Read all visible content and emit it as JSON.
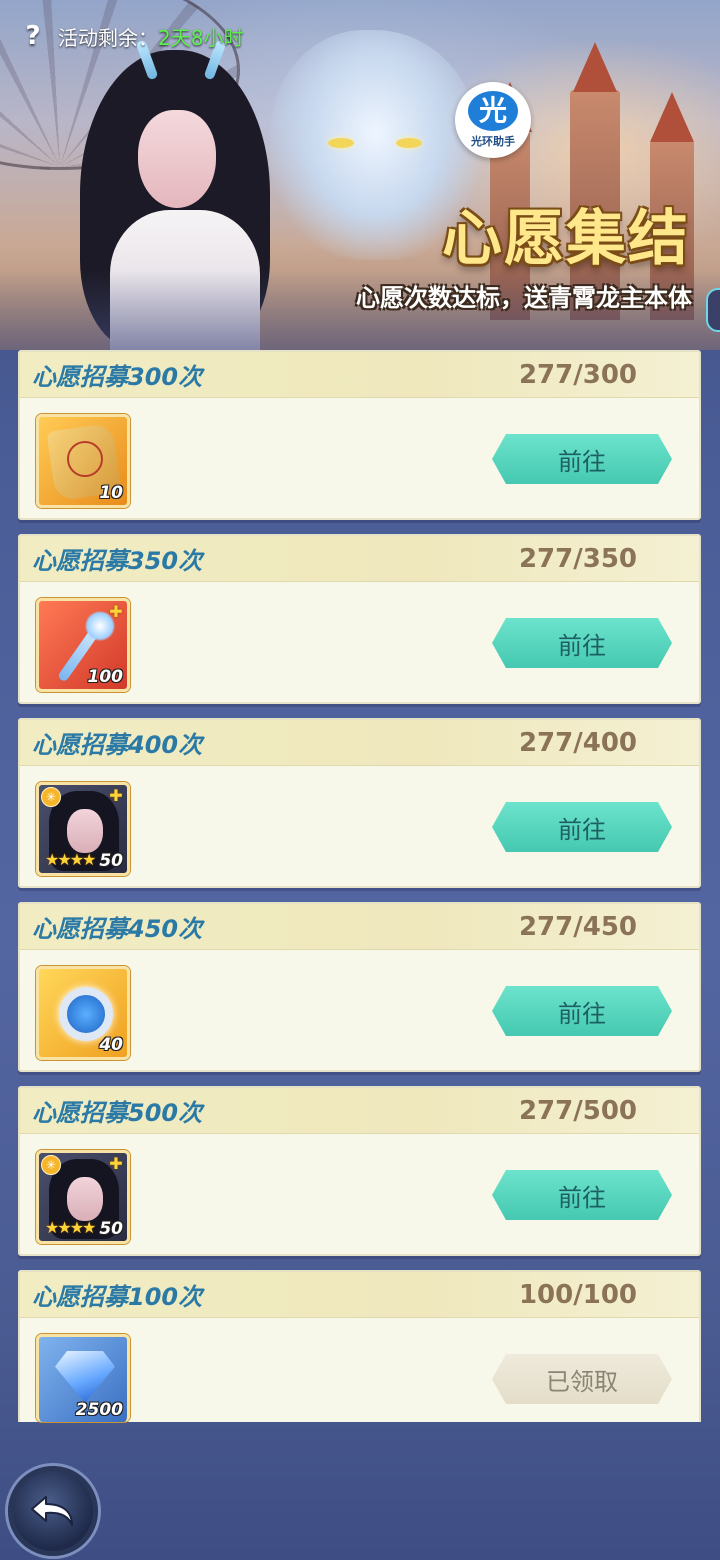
{
  "header": {
    "timer_label": "活动剩余：",
    "timer_value": "2天8小时",
    "logo_char": "光",
    "logo_text": "光环助手",
    "title": "心愿集结",
    "subtitle": "心愿次数达标，送青霄龙主本体"
  },
  "tasks": [
    {
      "title": "心愿招募300次",
      "progress": "277/300",
      "reward_count": "10",
      "reward_icon": "scroll-icon",
      "button": "前往"
    },
    {
      "title": "心愿招募350次",
      "progress": "277/350",
      "reward_count": "100",
      "reward_icon": "wand-shard-icon",
      "button": "前往"
    },
    {
      "title": "心愿招募400次",
      "progress": "277/400",
      "reward_count": "50",
      "reward_icon": "hero-shard-icon",
      "button": "前往"
    },
    {
      "title": "心愿招募450次",
      "progress": "277/450",
      "reward_count": "40",
      "reward_icon": "orb-icon",
      "button": "前往"
    },
    {
      "title": "心愿招募500次",
      "progress": "277/500",
      "reward_count": "50",
      "reward_icon": "hero-shard-icon",
      "button": "前往"
    },
    {
      "title": "心愿招募100次",
      "progress": "100/100",
      "reward_count": "2500",
      "reward_icon": "diamond-icon",
      "button": "已领取"
    }
  ],
  "colors": {
    "go_button": "#45c8b0",
    "claimed_button": "#e3ddc9",
    "task_title": "#2b7aa6",
    "timer_value": "#5ef04a"
  }
}
